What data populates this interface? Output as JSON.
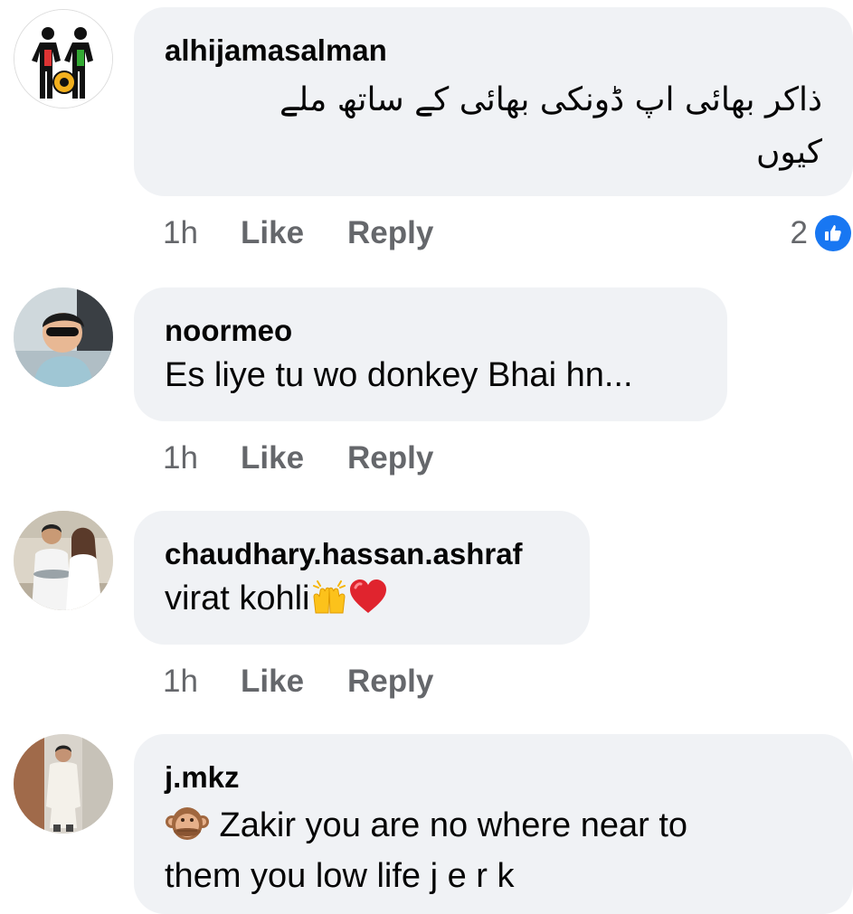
{
  "comments": [
    {
      "author": "alhijamasalman",
      "text_line1": "ذاکر بھائی اپ ڈونکی بھائی کے ساتھ ملے",
      "text_line2": "کیوں",
      "time": "1h",
      "like_label": "Like",
      "reply_label": "Reply",
      "reaction_count": "2",
      "reaction_icon": "like-thumbs-up-icon"
    },
    {
      "author": "noormeo",
      "text": "Es liye tu wo donkey Bhai hn...",
      "time": "1h",
      "like_label": "Like",
      "reply_label": "Reply"
    },
    {
      "author": "chaudhary.hassan.ashraf",
      "text": "virat kohli",
      "emojis": [
        "raising-hands-icon",
        "red-heart-icon"
      ],
      "time": "1h",
      "like_label": "Like",
      "reply_label": "Reply"
    },
    {
      "author": "j.mkz",
      "emoji": "speak-no-evil-monkey-icon",
      "text_line1": " Zakir you are no where near to",
      "text_line2": "them you low life j e r k"
    }
  ],
  "colors": {
    "bubble": "#f0f2f5",
    "secondary_text": "#65676b",
    "like_blue": "#1877f2"
  }
}
